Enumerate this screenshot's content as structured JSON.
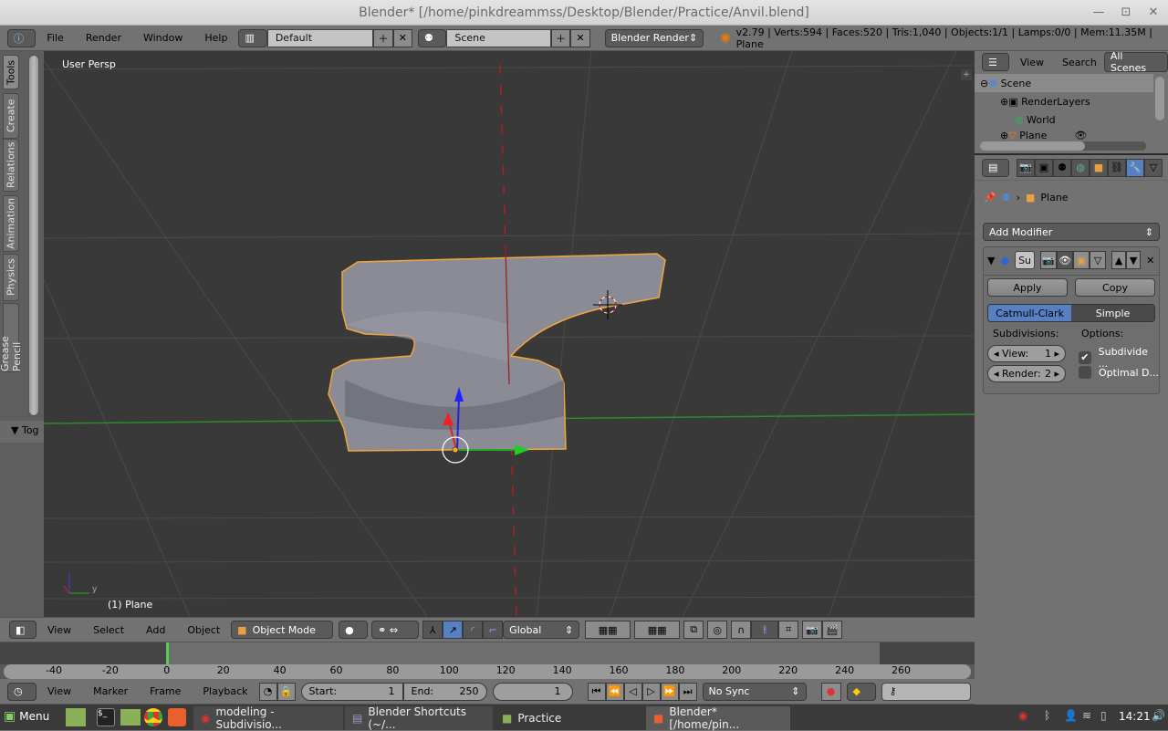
{
  "window": {
    "title": "Blender* [/home/pinkdreammss/Desktop/Blender/Practice/Anvil.blend]"
  },
  "info_header": {
    "menus": [
      "File",
      "Render",
      "Window",
      "Help"
    ],
    "layout": "Default",
    "scene": "Scene",
    "engine": "Blender Render",
    "stats": "v2.79 | Verts:594 | Faces:520 | Tris:1,040 | Objects:1/1 | Lamps:0/0 | Mem:11.35M | Plane"
  },
  "tool_shelf": {
    "tabs": [
      "Tools",
      "Create",
      "Relations",
      "Animation",
      "Physics",
      "Grease Pencil"
    ],
    "toggle": "Tog"
  },
  "viewport": {
    "view_label": "User Persp",
    "object_label": "(1) Plane",
    "axis_x": "y"
  },
  "outliner": {
    "menus": [
      "View",
      "Search"
    ],
    "filter": "All Scenes",
    "items": [
      "Scene",
      "RenderLayers",
      "World",
      "Plane"
    ]
  },
  "properties": {
    "breadcrumb_object": "Plane",
    "add_modifier": "Add Modifier",
    "modifier_name": "Su",
    "apply": "Apply",
    "copy": "Copy",
    "types": [
      "Catmull-Clark",
      "Simple"
    ],
    "active_type": "Catmull-Clark",
    "subdivisions_label": "Subdivisions:",
    "options_label": "Options:",
    "view_label": "View:",
    "view_value": "1",
    "render_label": "Render:",
    "render_value": "2",
    "opt_subdivide": "Subdivide ...",
    "opt_subdivide_checked": true,
    "opt_optimal": "Optimal D...",
    "opt_optimal_checked": false
  },
  "view3d_header": {
    "menus": [
      "View",
      "Select",
      "Add",
      "Object"
    ],
    "mode": "Object Mode",
    "orientation": "Global"
  },
  "timeline": {
    "ticks": [
      "-40",
      "-20",
      "0",
      "20",
      "40",
      "60",
      "80",
      "100",
      "120",
      "140",
      "160",
      "180",
      "200",
      "220",
      "240",
      "260"
    ],
    "current_frame_marker": 0
  },
  "timeline_header": {
    "menus": [
      "View",
      "Marker",
      "Frame",
      "Playback"
    ],
    "start_label": "Start:",
    "start": "1",
    "end_label": "End:",
    "end": "250",
    "current": "1",
    "sync": "No Sync"
  },
  "taskbar": {
    "menu": "Menu",
    "tasks": [
      "modeling - Subdivisio...",
      "Blender Shortcuts (~/...",
      "Practice",
      "Blender* [/home/pin..."
    ],
    "clock": "14:21"
  },
  "colors": {
    "accent": "#5680c2",
    "selection": "#f4a53a",
    "viewport_bg": "#393939"
  }
}
